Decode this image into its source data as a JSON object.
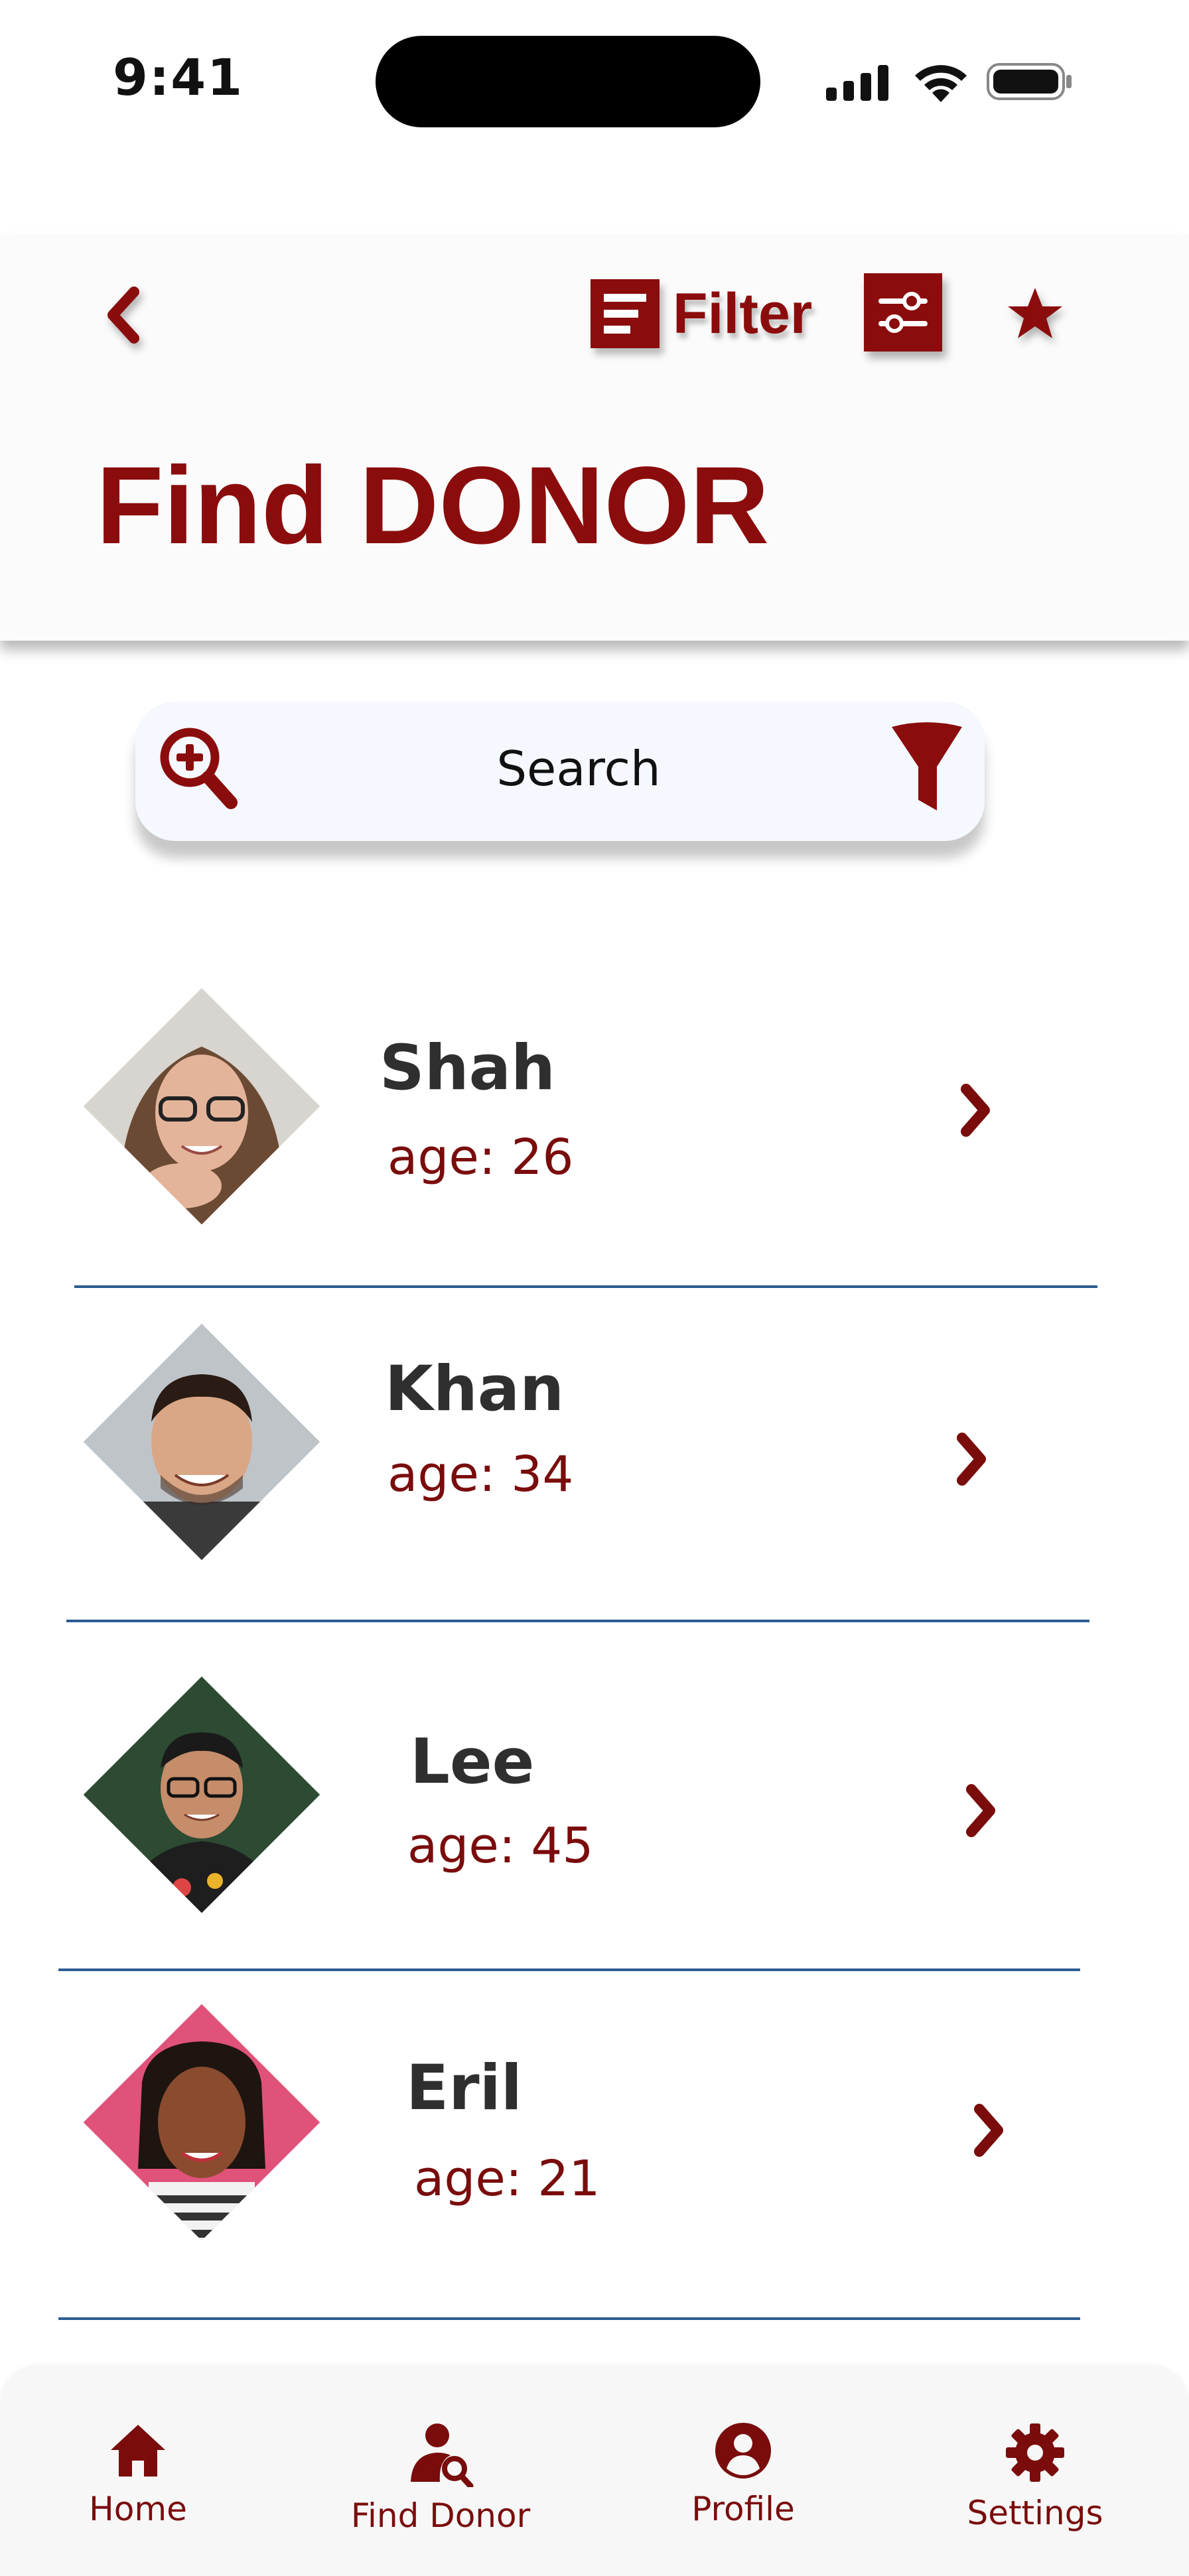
{
  "status_bar": {
    "time": "9:41"
  },
  "header": {
    "filter_label": "Filter",
    "title": "Find DONOR"
  },
  "search": {
    "placeholder": "Search"
  },
  "donors": [
    {
      "name": "Shah",
      "age": "age: 26"
    },
    {
      "name": "Khan",
      "age": "age: 34"
    },
    {
      "name": "Lee",
      "age": "age: 45"
    },
    {
      "name": "Eril",
      "age": "age: 21"
    }
  ],
  "bottom_nav": {
    "items": [
      {
        "label": "Home",
        "icon": "home-icon"
      },
      {
        "label": "Find Donor",
        "icon": "find-donor-icon"
      },
      {
        "label": "Profile",
        "icon": "profile-icon"
      },
      {
        "label": "Settings",
        "icon": "gear-icon"
      }
    ]
  },
  "colors": {
    "accent": "#8b0c0c",
    "divider": "#2e5b94",
    "header_bg": "#fbfbfb",
    "search_bg": "#f5f8fe"
  }
}
